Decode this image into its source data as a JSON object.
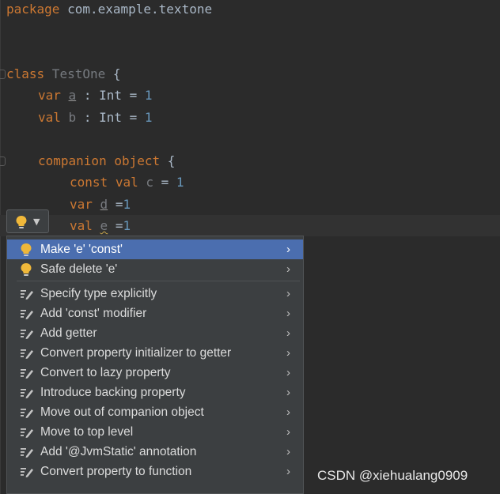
{
  "code": {
    "package_kw": "package",
    "package_name": " com.example.textone",
    "class_kw": "class",
    "class_name": " TestOne",
    "class_brace": " {",
    "var_kw": "var",
    "var_a": "a",
    "type_int": ": Int = ",
    "one": "1",
    "val_kw": "val",
    "val_b": "b",
    "companion_kw": "companion",
    "object_kw": "object",
    "brace": " {",
    "const_kw": "const",
    "val_c": "c",
    "eq": " = ",
    "var_d": "d",
    "val_e": "e",
    "eq_compact": " =",
    "one_compact": "1"
  },
  "intention_button": {
    "icon": "lightbulb-icon",
    "caret": "▼"
  },
  "intention_menu": {
    "items": [
      {
        "label": "Make 'e' 'const'",
        "icon": "lightbulb-icon",
        "selected": true
      },
      {
        "label": "Safe delete 'e'",
        "icon": "lightbulb-icon",
        "selected": false
      },
      {
        "label": "Specify type explicitly",
        "icon": "edit-intention-icon",
        "selected": false
      },
      {
        "label": "Add 'const' modifier",
        "icon": "edit-intention-icon",
        "selected": false
      },
      {
        "label": "Add getter",
        "icon": "edit-intention-icon",
        "selected": false
      },
      {
        "label": "Convert property initializer to getter",
        "icon": "edit-intention-icon",
        "selected": false
      },
      {
        "label": "Convert to lazy property",
        "icon": "edit-intention-icon",
        "selected": false
      },
      {
        "label": "Introduce backing property",
        "icon": "edit-intention-icon",
        "selected": false
      },
      {
        "label": "Move out of companion object",
        "icon": "edit-intention-icon",
        "selected": false
      },
      {
        "label": "Move to top level",
        "icon": "edit-intention-icon",
        "selected": false
      },
      {
        "label": "Add '@JvmStatic' annotation",
        "icon": "edit-intention-icon",
        "selected": false
      },
      {
        "label": "Convert property to function",
        "icon": "edit-intention-icon",
        "selected": false
      }
    ],
    "submenu_arrow": "›"
  },
  "watermark": "CSDN @xiehualang0909",
  "colors": {
    "background": "#2b2b2b",
    "keyword": "#cc7832",
    "number": "#6897bb",
    "selection": "#4b6eaf",
    "bulb": "#f0b83a"
  }
}
